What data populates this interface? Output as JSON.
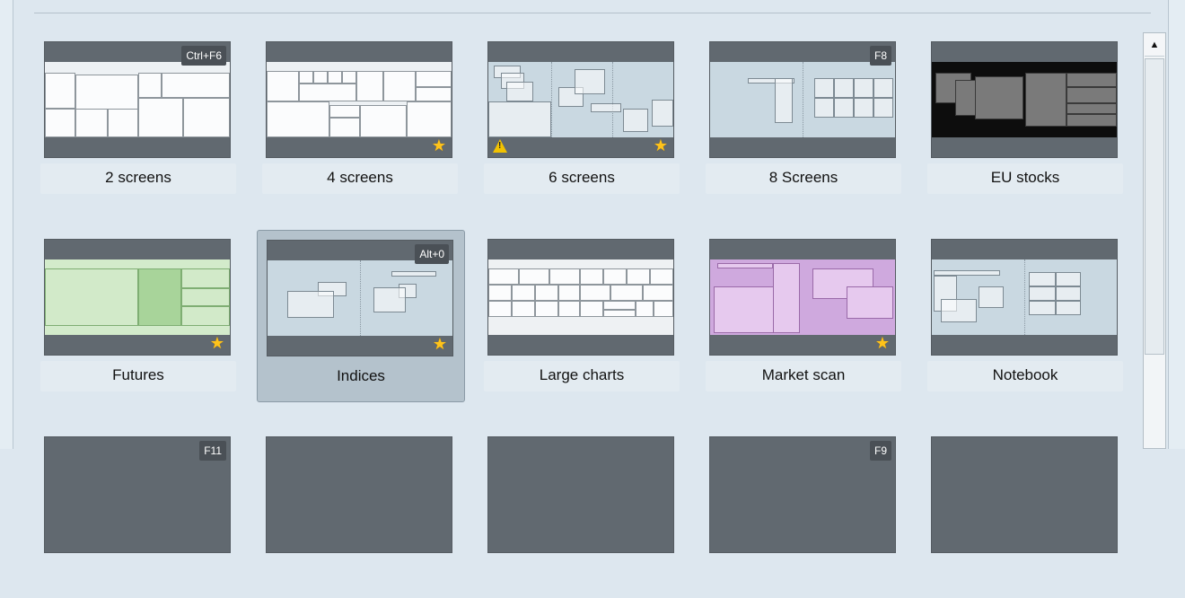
{
  "layouts": [
    {
      "label": "2 screens",
      "shortcut": "Ctrl+F6",
      "favorite": false,
      "warning": false,
      "selected": false
    },
    {
      "label": "4 screens",
      "shortcut": "",
      "favorite": true,
      "warning": false,
      "selected": false
    },
    {
      "label": "6 screens",
      "shortcut": "",
      "favorite": true,
      "warning": true,
      "selected": false
    },
    {
      "label": "8 Screens",
      "shortcut": "F8",
      "favorite": false,
      "warning": false,
      "selected": false
    },
    {
      "label": "EU stocks",
      "shortcut": "",
      "favorite": false,
      "warning": false,
      "selected": false
    },
    {
      "label": "Futures",
      "shortcut": "",
      "favorite": true,
      "warning": false,
      "selected": false
    },
    {
      "label": "Indices",
      "shortcut": "Alt+0",
      "favorite": true,
      "warning": false,
      "selected": true
    },
    {
      "label": "Large charts",
      "shortcut": "",
      "favorite": false,
      "warning": false,
      "selected": false
    },
    {
      "label": "Market scan",
      "shortcut": "",
      "favorite": true,
      "warning": false,
      "selected": false
    },
    {
      "label": "Notebook",
      "shortcut": "",
      "favorite": false,
      "warning": false,
      "selected": false
    },
    {
      "label": "",
      "shortcut": "F11",
      "favorite": false,
      "warning": false,
      "selected": false
    },
    {
      "label": "",
      "shortcut": "",
      "favorite": false,
      "warning": false,
      "selected": false
    },
    {
      "label": "",
      "shortcut": "",
      "favorite": false,
      "warning": false,
      "selected": false
    },
    {
      "label": "",
      "shortcut": "F9",
      "favorite": false,
      "warning": false,
      "selected": false
    },
    {
      "label": "",
      "shortcut": "",
      "favorite": false,
      "warning": false,
      "selected": false
    }
  ],
  "icons": {
    "star": "star-icon",
    "warning": "warning-icon",
    "scroll_up": "arrow-up-icon"
  },
  "colors": {
    "accent_star": "#ffc31a",
    "thumb_frame": "#616970",
    "selected_bg": "#b4c2cc"
  }
}
